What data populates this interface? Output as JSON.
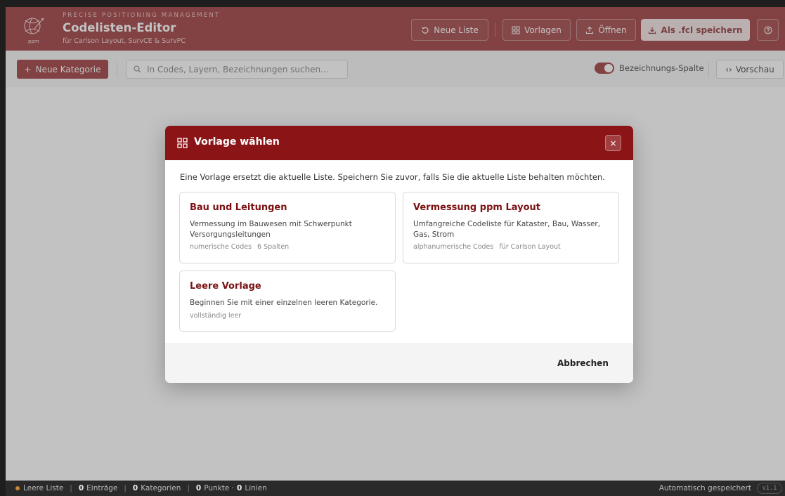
{
  "header": {
    "sup": "PRECISE POSITIONING MANAGEMENT",
    "title": "Codelisten-Editor",
    "subtitle": "für Carlson Layout, SurvCE & SurvPC",
    "logo_text": "ppm",
    "buttons": {
      "new_list": "Neue Liste",
      "templates": "Vorlagen",
      "open": "Öffnen",
      "save": "Als .fcl speichern"
    }
  },
  "toolbar": {
    "new_category": "Neue Kategorie",
    "search_placeholder": "In Codes, Layern, Bezeichnungen suchen...",
    "toggle_label": "Bezeichnungs-Spalte",
    "preview": "Vorschau"
  },
  "modal": {
    "title": "Vorlage wählen",
    "close": "×",
    "description": "Eine Vorlage ersetzt die aktuelle Liste. Speichern Sie zuvor, falls Sie die aktuelle Liste behalten möchten.",
    "cards": [
      {
        "title": "Bau und Leitungen",
        "description": "Vermessung im Bauwesen mit Schwerpunkt Versorgungsleitungen",
        "meta": [
          "numerische Codes",
          "6 Spalten"
        ]
      },
      {
        "title": "Vermessung ppm Layout",
        "description": "Umfangreiche Codeliste für Kataster, Bau, Wasser, Gas, Strom",
        "meta": [
          "alphanumerische Codes",
          "für Carlson Layout"
        ]
      },
      {
        "title": "Leere Vorlage",
        "description": "Beginnen Sie mit einer einzelnen leeren Kategorie.",
        "meta": [
          "vollständig leer"
        ]
      }
    ],
    "cancel": "Abbrechen"
  },
  "statusbar": {
    "list_state": "Leere Liste",
    "entries_count": "0",
    "entries_label": "Einträge",
    "categories_count": "0",
    "categories_label": "Kategorien",
    "points_count": "0",
    "points_label": "Punkte ·",
    "lines_count": "0",
    "lines_label": "Linien",
    "autosave": "Automatisch gespeichert",
    "version": "v1.1"
  },
  "colors": {
    "brand": "#8b1416",
    "brand_dark": "#7a1113",
    "status_dot": "#c8853a"
  }
}
